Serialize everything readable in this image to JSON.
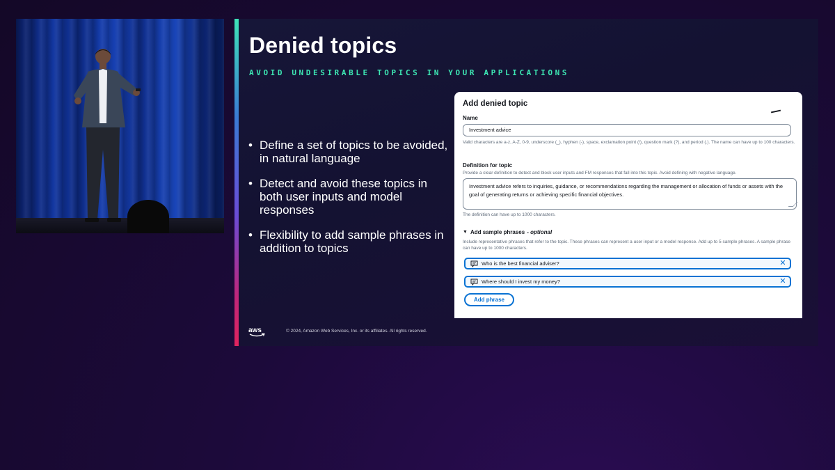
{
  "slide": {
    "title": "Denied topics",
    "subtitle": "AVOID UNDESIRABLE TOPICS IN YOUR APPLICATIONS",
    "bullets": [
      "Define a set of topics to be avoided, in natural language",
      "Detect and avoid these topics in both user inputs and model responses",
      "Flexibility to add sample phrases in addition to topics"
    ],
    "logo": "aws",
    "copyright": "© 2024, Amazon Web Services, Inc. or its affiliates. All rights reserved."
  },
  "form": {
    "title": "Add denied topic",
    "name_label": "Name",
    "name_value": "Investment advice",
    "name_hint": "Valid characters are a-z, A-Z, 0-9, underscore (_), hyphen (-), space, exclamation point (!), question mark (?), and period (.). The name can have up to 100 characters.",
    "definition_label": "Definition for topic",
    "definition_description": "Provide a clear definition to detect and block user inputs and FM responses that fall into this topic. Avoid defining with negative language.",
    "definition_value": "Investment advice refers to inquiries, guidance, or recommendations regarding the management or allocation of funds or assets with the goal of generating returns or achieving specific financial objectives.",
    "definition_hint": "The definition can have up to 1000 characters.",
    "phrases_label": "Add sample phrases",
    "phrases_optional": "- optional",
    "phrases_description": "Include representative phrases that refer to the topic. These phrases can represent a user input or a model response. Add up to 5 sample phrases. A sample phrase can have up to 1000 characters.",
    "phrases": [
      "Who is the best financial adviser?",
      "Where should I invest my money?"
    ],
    "add_phrase_label": "Add phrase"
  },
  "colors": {
    "accent_teal": "#3de6b3",
    "console_blue": "#0972d3"
  },
  "icons": {
    "phrase": "chat-bubble-icon",
    "remove": "close-icon",
    "expander": "caret-down-icon"
  }
}
